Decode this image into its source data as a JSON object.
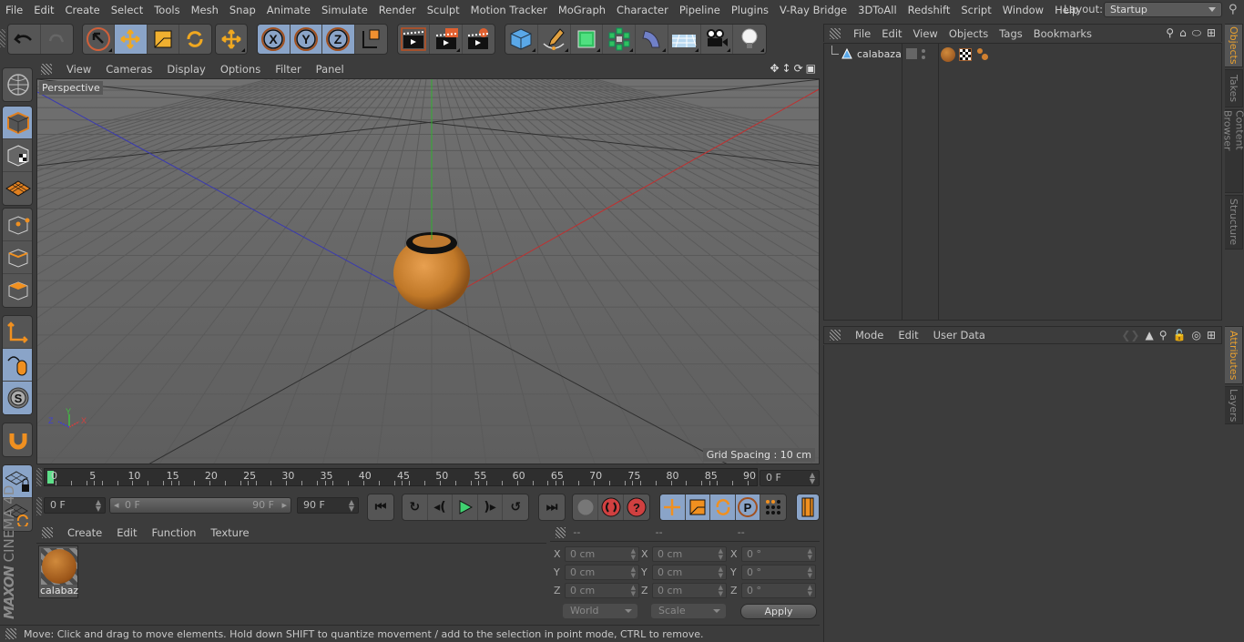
{
  "menubar": {
    "items": [
      "File",
      "Edit",
      "Create",
      "Select",
      "Tools",
      "Mesh",
      "Snap",
      "Animate",
      "Simulate",
      "Render",
      "Sculpt",
      "Motion Tracker",
      "MoGraph",
      "Character",
      "Pipeline",
      "Plugins",
      "V-Ray Bridge",
      "3DToAll",
      "Redshift",
      "Script",
      "Window",
      "Help"
    ],
    "layout_label": "Layout:",
    "layout_value": "Startup"
  },
  "toolbar": {
    "undo": "undo-icon",
    "redo": "redo-icon",
    "tools": [
      "select",
      "move",
      "scale",
      "rotate",
      "last-tool"
    ],
    "axes": [
      "X",
      "Y",
      "Z"
    ],
    "coord_system": "world-coordinate-system",
    "render": [
      "render-view",
      "render-to-picture-viewer",
      "edit-render-settings"
    ],
    "create": [
      "cube",
      "pen",
      "subdivision-surface",
      "cloner",
      "deformer",
      "floor",
      "camera",
      "light"
    ]
  },
  "viewport": {
    "menu": [
      "View",
      "Cameras",
      "Display",
      "Options",
      "Filter",
      "Panel"
    ],
    "label": "Perspective",
    "grid_spacing": "Grid Spacing : 10 cm",
    "axis_labels": {
      "x": "X",
      "y": "Y",
      "z": "Z"
    }
  },
  "left_tools": [
    "model",
    "texture",
    "workplane",
    "points",
    "edges",
    "polygons",
    "axis",
    "tweak",
    "solo",
    "snap",
    "lock-workplane",
    "workplane-rotate"
  ],
  "logo": {
    "brand": "MAXON",
    "product": "CINEMA 4D"
  },
  "timeline": {
    "ticks": [
      "0",
      "5",
      "10",
      "15",
      "20",
      "25",
      "30",
      "35",
      "40",
      "45",
      "50",
      "55",
      "60",
      "65",
      "70",
      "75",
      "80",
      "85",
      "90"
    ],
    "current_frame": "0 F",
    "start_field": "0 F",
    "range_start": "0 F",
    "range_end": "90 F",
    "end_field": "90 F",
    "max": 90
  },
  "material_manager": {
    "menu": [
      "Create",
      "Edit",
      "Function",
      "Texture"
    ],
    "materials": [
      {
        "name": "calabaza"
      }
    ]
  },
  "coordinates": {
    "headers": [
      "--",
      "--",
      "--"
    ],
    "rows": [
      {
        "axis": "X",
        "pos": "0 cm",
        "size": "0 cm",
        "rot": "0 °"
      },
      {
        "axis": "Y",
        "pos": "0 cm",
        "size": "0 cm",
        "rot": "0 °"
      },
      {
        "axis": "Z",
        "pos": "0 cm",
        "size": "0 cm",
        "rot": "0 °"
      }
    ],
    "mode_select": "World",
    "size_select": "Scale",
    "apply_label": "Apply"
  },
  "status_text": "Move: Click and drag to move elements. Hold down SHIFT to quantize movement / add to the selection in point mode, CTRL to remove.",
  "object_manager": {
    "menu": [
      "File",
      "Edit",
      "View",
      "Objects",
      "Tags",
      "Bookmarks"
    ],
    "objects": [
      {
        "name": "calabaza"
      }
    ]
  },
  "attributes": {
    "menu": [
      "Mode",
      "Edit",
      "User Data"
    ]
  },
  "side_tabs": {
    "top": [
      "Objects",
      "Takes",
      "Content Browser",
      "Structure"
    ],
    "bottom": [
      "Attributes",
      "Layers"
    ]
  },
  "colors": {
    "accent_active": "#8aa4c8",
    "tab_active": "#e8a030",
    "timeline_cursor": "#5ee08a"
  }
}
